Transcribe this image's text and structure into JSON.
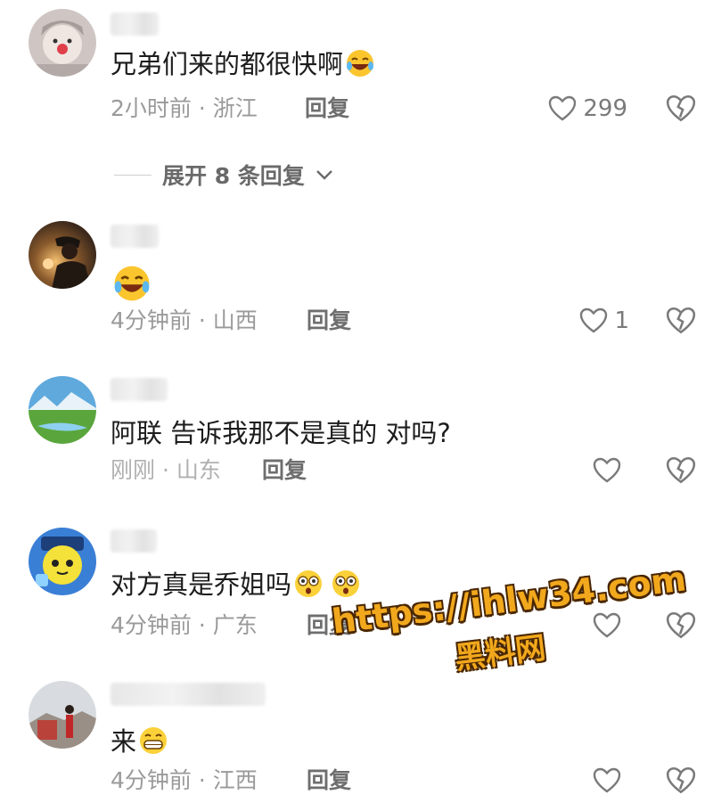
{
  "comments": [
    {
      "text": "兄弟们来的都很快啊",
      "emoji": "laughing-with-tears",
      "time_location": "2小时前 · 浙江",
      "reply_label": "回复",
      "like_count": "299"
    },
    {
      "text": "",
      "emoji": "laughing-with-tears",
      "time_location": "4分钟前 · 山西",
      "reply_label": "回复",
      "like_count": "1"
    },
    {
      "text": "阿联 告诉我那不是真的 对吗?",
      "time_location": "刚刚 · 山东",
      "reply_label": "回复",
      "like_count": ""
    },
    {
      "text": "对方真是乔姐吗",
      "emoji": "flushed-face x2",
      "time_location": "4分钟前 · 广东",
      "reply_label": "回复",
      "like_count": ""
    },
    {
      "text": "来",
      "emoji": "grinning-face",
      "time_location": "4分钟前 · 江西",
      "reply_label": "回复",
      "like_count": ""
    }
  ],
  "expand_replies": "展开 8 条回复",
  "watermark": {
    "url": "https://ihlw34.com",
    "name": "黑料网"
  },
  "colors": {
    "text": "#161616",
    "meta": "#9a9a9a",
    "icon": "#7a7a7a",
    "watermark": "#f2a81d"
  }
}
